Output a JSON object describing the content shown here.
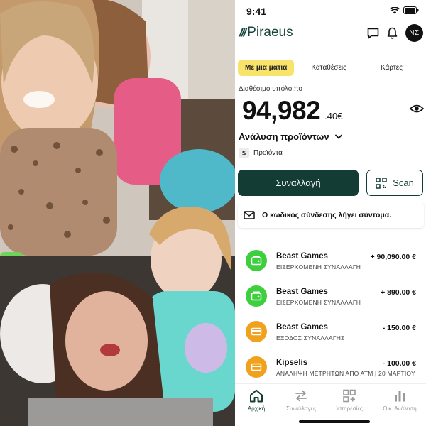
{
  "status_bar": {
    "time": "9:41"
  },
  "header": {
    "logo_mark": "///",
    "logo_text": "Piraeus",
    "avatar_initials": "ΝΣ"
  },
  "tabs": [
    {
      "label": "Με μια ματιά",
      "active": true
    },
    {
      "label": "Καταθέσεις",
      "active": false
    },
    {
      "label": "Κάρτες",
      "active": false
    }
  ],
  "balance": {
    "label": "Διαθέσιμο υπόλοιπο",
    "main": "94,982",
    "decimals": ".40€"
  },
  "analysis": {
    "label": "Ανάλυση προϊόντων",
    "count": "5",
    "count_label": "Προϊόντα"
  },
  "actions": {
    "primary_label": "Συναλλαγή",
    "scan_label": "Scan"
  },
  "notice": {
    "text": "Ο κωδικός σύνδεσης λήγει σύντομα."
  },
  "transactions": [
    {
      "name": "Beast Games",
      "subtitle": "ΕΙΣΕΡΧΟΜΕΝΗ ΣΥΝΑΛΛΑΓΗ",
      "amount": "+ 90,090.00 €",
      "color": "#3ecf3e"
    },
    {
      "name": "Beast Games",
      "subtitle": "ΕΙΣΕΡΧΟΜΕΝΗ ΣΥΝΑΛΛΑΓΗ",
      "amount": "+ 890.00 €",
      "color": "#3ecf3e"
    },
    {
      "name": "Beast Games",
      "subtitle": "ΕΞΟΔΟΣ ΣΥΝΑΛΛΑΓΗΣ",
      "amount": "- 150.00 €",
      "color": "#f0a21e"
    },
    {
      "name": "Kipselis",
      "subtitle": "ΑΝΑΛΗΨΗ ΜΕΤΡΗΤΩΝ ΑΠΟ ΑΤΜ | 20 ΜΑΡΤΙΟΥ",
      "amount": "- 100.00 €",
      "color": "#f0a21e"
    }
  ],
  "bottom_nav": [
    {
      "label": "Αρχική",
      "icon": "home-icon",
      "active": true
    },
    {
      "label": "Συναλλαγές",
      "icon": "transfer-arrows-icon",
      "active": false
    },
    {
      "label": "Υπηρεσίες",
      "icon": "services-grid-icon",
      "active": false
    },
    {
      "label": "Οικ. Ανάλυση",
      "icon": "bar-chart-icon",
      "active": false
    }
  ],
  "colors": {
    "brand": "#133c35",
    "tab_active": "#f8e36b",
    "incoming": "#3ecf3e",
    "outgoing": "#f0a21e"
  }
}
